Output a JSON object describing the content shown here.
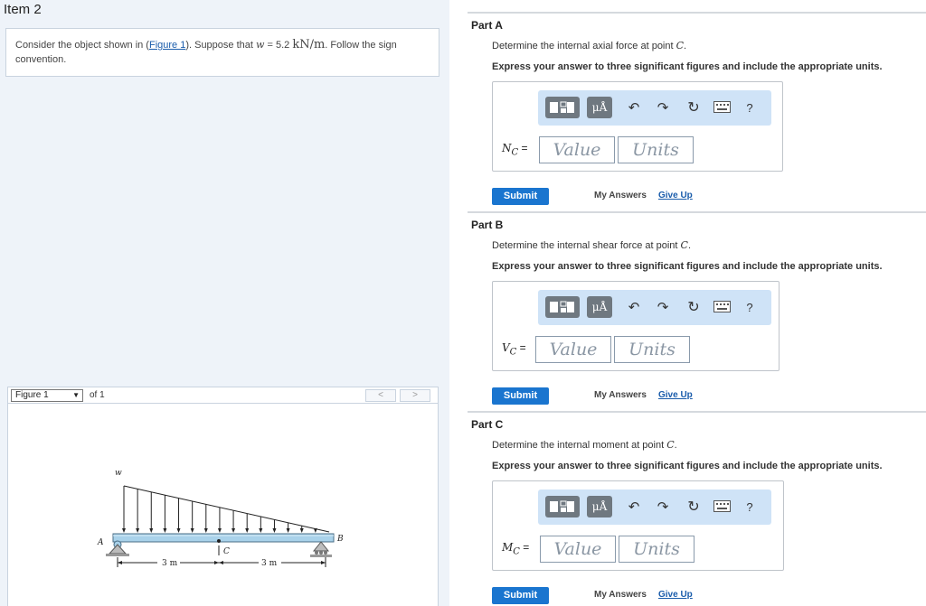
{
  "item": {
    "title": "Item 2"
  },
  "problem": {
    "text_before": "Consider the object shown in (",
    "figure_link": "Figure 1",
    "text_mid": "). Suppose that ",
    "w_symbol": "w",
    "w_value": " = 5.2 ",
    "w_unit": "kN/m",
    "text_after": ". Follow the sign convention."
  },
  "figure_nav": {
    "select_value": "Figure 1",
    "of_label": "of 1",
    "prev_label": "<",
    "next_label": ">"
  },
  "figure": {
    "load_label": "w",
    "support_a_label": "A",
    "end_b_label": "B",
    "point_c_label": "C",
    "dim_left": "3 m",
    "dim_right": "3 m"
  },
  "toolbar": {
    "units_icon_label": "μÅ",
    "undo_glyph": "↶",
    "redo_glyph": "↷",
    "reset_glyph": "↻",
    "help_label": "?"
  },
  "parts": [
    {
      "title": "Part A",
      "question_prefix": "Determine the internal axial force at point ",
      "point": "C",
      "question_suffix": ".",
      "instructions": "Express your answer to three significant figures and include the appropriate units.",
      "var_symbol": "N",
      "var_sub": "C",
      "var_eq": " =",
      "value_placeholder": "Value",
      "units_placeholder": "Units",
      "submit_label": "Submit",
      "my_answers_label": "My Answers",
      "give_up_label": "Give Up"
    },
    {
      "title": "Part B",
      "question_prefix": "Determine the internal shear force at point ",
      "point": "C",
      "question_suffix": ".",
      "instructions": "Express your answer to three significant figures and include the appropriate units.",
      "var_symbol": "V",
      "var_sub": "C",
      "var_eq": " =",
      "value_placeholder": "Value",
      "units_placeholder": "Units",
      "submit_label": "Submit",
      "my_answers_label": "My Answers",
      "give_up_label": "Give Up"
    },
    {
      "title": "Part C",
      "question_prefix": "Determine the internal moment at point ",
      "point": "C",
      "question_suffix": ".",
      "instructions": "Express your answer to three significant figures and include the appropriate units.",
      "var_symbol": "M",
      "var_sub": "C",
      "var_eq": " =",
      "value_placeholder": "Value",
      "units_placeholder": "Units",
      "submit_label": "Submit",
      "my_answers_label": "My Answers",
      "give_up_label": "Give Up"
    }
  ],
  "colors": {
    "accent_blue": "#1a75cf",
    "link_blue": "#1a5cab",
    "toolbar_bg": "#cfe3f7",
    "panel_bg": "#eef3f9",
    "beam_fill": "#a9d2ea"
  }
}
